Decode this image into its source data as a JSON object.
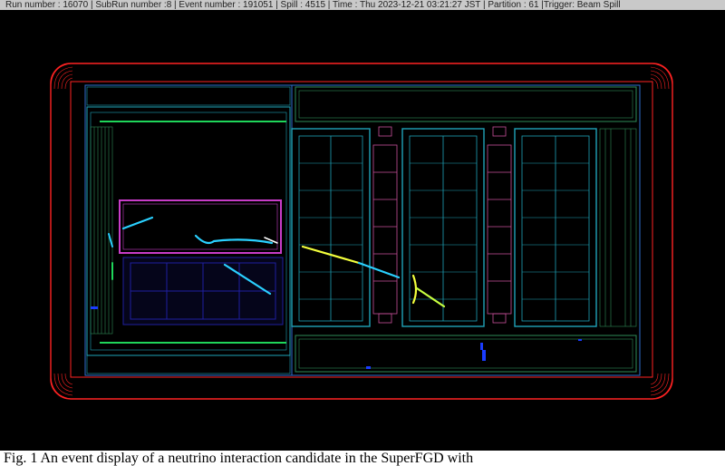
{
  "info_bar": {
    "text": "Run number : 16070 | SubRun number :8 | Event number : 191051 | Spill : 4515 | Time : Thu 2023-12-21 03:21:27 JST | Partition : 61 |Trigger: Beam Spill"
  },
  "caption": {
    "text": "Fig. 1 An event display of a neutrino interaction candidate in the SuperFGD with"
  },
  "colors": {
    "background": "#000000",
    "magnet": "#ff2222",
    "outer_frame": "#3a7bd5",
    "ecal": "#2e8b57",
    "tpc": "#1fa3b8",
    "superfgd": "#c83cc8",
    "fgd_module": "#c8509a",
    "tracks_hot": "#f3ff3c",
    "tracks_cold": "#2ad0ff"
  }
}
